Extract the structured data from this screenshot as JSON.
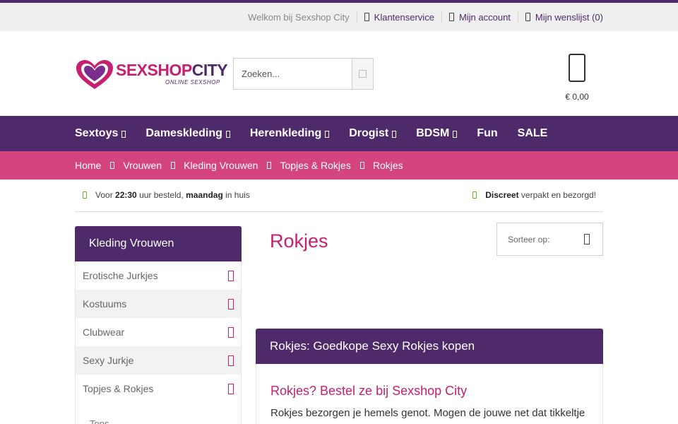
{
  "topbar": {
    "welcome": "Welkom bij Sexshop City",
    "links": [
      {
        "label": "Klantenservice",
        "icon": "phone-icon"
      },
      {
        "label": "Mijn account",
        "icon": "user-icon"
      },
      {
        "label": "Mijn wenslijst (0)",
        "icon": "heart-icon"
      }
    ]
  },
  "header": {
    "logo": {
      "brand_a": "SEXSHOP",
      "brand_b": "CITY",
      "tagline": "ONLINE SEXSHOP"
    },
    "search": {
      "placeholder": "Zoeken...",
      "icon": "search-icon"
    },
    "cart": {
      "amount": "€ 0,00",
      "icon": "shopping-bag-icon"
    }
  },
  "nav": {
    "items": [
      {
        "label": "Sextoys",
        "dropdown": true
      },
      {
        "label": "Dameskleding",
        "dropdown": true
      },
      {
        "label": "Herenkleding",
        "dropdown": true
      },
      {
        "label": "Drogist",
        "dropdown": true
      },
      {
        "label": "BDSM",
        "dropdown": true
      },
      {
        "label": "Fun",
        "dropdown": false
      },
      {
        "label": "SALE",
        "dropdown": false
      }
    ]
  },
  "breadcrumb": [
    "Home",
    "Vrouwen",
    "Kleding Vrouwen",
    "Topjes & Rokjes",
    "Rokjes"
  ],
  "usp": {
    "left": {
      "pre": "Voor ",
      "time": "22:30",
      "mid": " uur besteld, ",
      "day": "maandag",
      "post": " in huis"
    },
    "right": {
      "strong": "Discreet",
      "rest": " verpakt en bezorgd!"
    }
  },
  "sidebar": {
    "title": "Kleding Vrouwen",
    "items": [
      "Erotische Jurkjes",
      "Kostuums",
      "Clubwear",
      "Sexy Jurkje",
      "Topjes & Rokjes"
    ],
    "sub_item": "Tops"
  },
  "main": {
    "title": "Rokjes",
    "sort_label": "Sorteer op:",
    "panel": {
      "header": "Rokjes: Goedkope Sexy Rokjes kopen",
      "heading": "Rokjes? Bestel ze bij Sexshop City",
      "text": "Rokjes bezorgen je hemels genot. Mogen de jouwe net dat tikkeltje"
    }
  },
  "colors": {
    "purple": "#4f2a6b",
    "pink": "#c6206e",
    "breadcrumb_pink": "#d4457f",
    "check_green": "#66b81d"
  }
}
